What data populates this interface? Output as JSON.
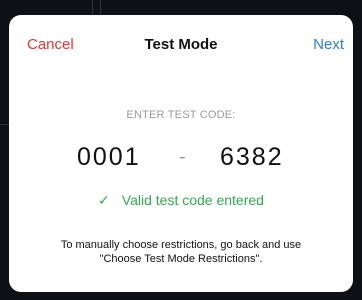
{
  "nav": {
    "cancel_label": "Cancel",
    "title": "Test Mode",
    "next_label": "Next"
  },
  "code_entry": {
    "label": "ENTER TEST CODE:",
    "part1": "0001",
    "separator": "-",
    "part2": "6382"
  },
  "status": {
    "icon": "checkmark-icon",
    "glyph": "✓",
    "text": "Valid test code entered"
  },
  "note": {
    "line1": "To manually choose restrictions, go back and use",
    "line2": "\"Choose Test Mode Restrictions\"."
  },
  "colors": {
    "cancel": "#e03a2f",
    "next": "#2f7de1",
    "valid": "#34a853"
  }
}
